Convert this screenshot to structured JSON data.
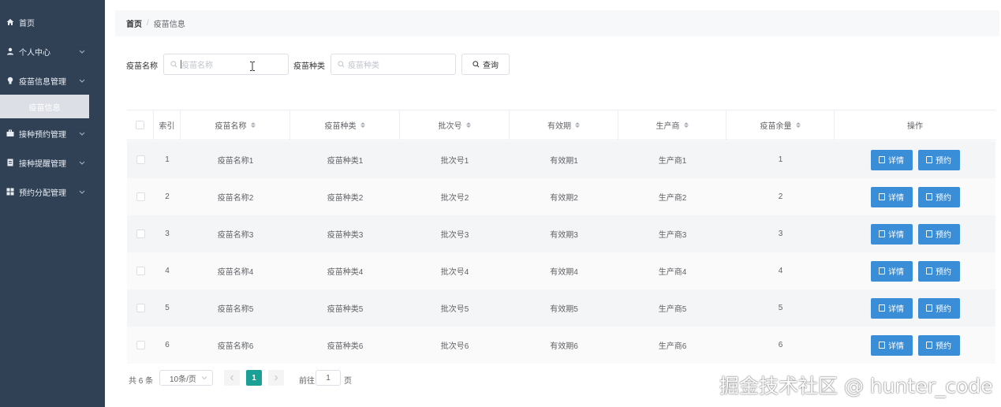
{
  "sidebar": {
    "items": [
      {
        "label": "首页",
        "icon": "home-icon",
        "has_chevron": false
      },
      {
        "label": "个人中心",
        "icon": "user-icon",
        "has_chevron": true
      },
      {
        "label": "疫苗信息管理",
        "icon": "bulb-icon",
        "has_chevron": true
      },
      {
        "label": "接种预约管理",
        "icon": "briefcase-icon",
        "has_chevron": true
      },
      {
        "label": "接种提醒管理",
        "icon": "list-icon",
        "has_chevron": true
      },
      {
        "label": "预约分配管理",
        "icon": "grid-icon",
        "has_chevron": true
      }
    ],
    "active_sub": "疫苗信息",
    "bg_color": "#304156"
  },
  "breadcrumb": {
    "home": "首页",
    "sep": "/",
    "current": "疫苗信息"
  },
  "search": {
    "name_label": "疫苗名称",
    "name_placeholder": "疫苗名称",
    "type_label": "疫苗种类",
    "type_placeholder": "疫苗种类",
    "button_label": "查询"
  },
  "table": {
    "columns": [
      "索引",
      "疫苗名称",
      "疫苗种类",
      "批次号",
      "有效期",
      "生产商",
      "疫苗余量",
      "操作"
    ],
    "rows": [
      {
        "idx": "1",
        "name": "疫苗名称1",
        "type": "疫苗种类1",
        "batch": "批次号1",
        "valid": "有效期1",
        "mfr": "生产商1",
        "stock": "1"
      },
      {
        "idx": "2",
        "name": "疫苗名称2",
        "type": "疫苗种类2",
        "batch": "批次号2",
        "valid": "有效期2",
        "mfr": "生产商2",
        "stock": "2"
      },
      {
        "idx": "3",
        "name": "疫苗名称3",
        "type": "疫苗种类3",
        "batch": "批次号3",
        "valid": "有效期3",
        "mfr": "生产商3",
        "stock": "3"
      },
      {
        "idx": "4",
        "name": "疫苗名称4",
        "type": "疫苗种类4",
        "batch": "批次号4",
        "valid": "有效期4",
        "mfr": "生产商4",
        "stock": "4"
      },
      {
        "idx": "5",
        "name": "疫苗名称5",
        "type": "疫苗种类5",
        "batch": "批次号5",
        "valid": "有效期5",
        "mfr": "生产商5",
        "stock": "5"
      },
      {
        "idx": "6",
        "name": "疫苗名称6",
        "type": "疫苗种类6",
        "batch": "批次号6",
        "valid": "有效期6",
        "mfr": "生产商6",
        "stock": "6"
      }
    ],
    "detail_label": "详情",
    "book_label": "预约",
    "button_color": "#3a8ed8"
  },
  "pagination": {
    "total": "共 6 条",
    "page_size": "10条/页",
    "current_page": "1",
    "goto_prefix": "前往",
    "goto_value": "1",
    "goto_suffix": "页",
    "active_color": "#1aa094"
  },
  "watermark": "掘金技术社区 @ hunter_code"
}
